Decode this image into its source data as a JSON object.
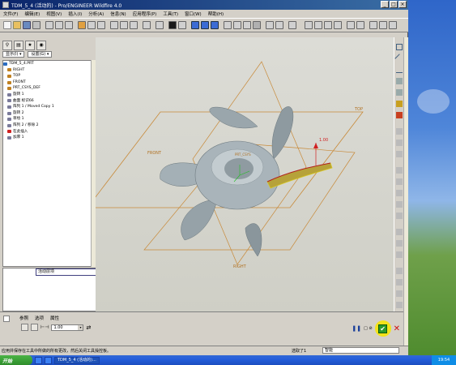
{
  "window": {
    "title": "TDM_5_4 (活动的) - Pro/ENGINEER Wildfire 4.0",
    "controls": [
      "_",
      "□",
      "×"
    ]
  },
  "menu": [
    "文件(F)",
    "编辑(E)",
    "视图(V)",
    "插入(I)",
    "分析(A)",
    "信息(N)",
    "应用程序(P)",
    "工具(T)",
    "窗口(W)",
    "帮助(H)"
  ],
  "tree": {
    "display_label": "显示(I) ▾",
    "settings_label": "设置(G) ▾",
    "items": [
      {
        "label": "TDM_5_4.PRT",
        "color": "#2a6cc0"
      },
      {
        "label": "RIGHT",
        "color": "#c08020"
      },
      {
        "label": "TOP",
        "color": "#c08020"
      },
      {
        "label": "FRONT",
        "color": "#c08020"
      },
      {
        "label": "PRT_CSYS_DEF",
        "color": "#c08020"
      },
      {
        "label": "旋转 1",
        "color": "#7a7a9a"
      },
      {
        "label": "曲面 标识66",
        "color": "#7a7a9a"
      },
      {
        "label": "阵列 1 / Moved Copy 1",
        "color": "#7a7a9a"
      },
      {
        "label": "旋转 2",
        "color": "#7a7a9a"
      },
      {
        "label": "草绘 1",
        "color": "#7a7a9a"
      },
      {
        "label": "阵列 2 / 移除 2",
        "color": "#7a7a9a"
      },
      {
        "label": "在此插入",
        "color": "#d02020"
      },
      {
        "label": "加厚 1",
        "color": "#7a7a9a"
      }
    ]
  },
  "smart_filter": "活动层项",
  "viewport": {
    "labels": {
      "top": "TOP",
      "right_left": "FRONT",
      "right_bottom": "RIGHT",
      "csys": "PRT_CSYS",
      "dim": "1.00"
    }
  },
  "dashboard": {
    "tabs": [
      "参照",
      "选项",
      "属性"
    ],
    "thickness_value": "1.00",
    "checkbox_label": "□ ⊘",
    "ok_symbol": "✔",
    "cancel_symbol": "✕",
    "pause_symbol": "❚❚"
  },
  "status": {
    "message": "应用并保存在工具中所做的所有更改，然后关闭工具操控板。",
    "filter_label": "选取了1",
    "filter_value": "智能"
  },
  "taskbar": {
    "start": "开始",
    "tasks": [
      "TDM_5_4 (活动的)..."
    ],
    "clock": "19:54"
  }
}
